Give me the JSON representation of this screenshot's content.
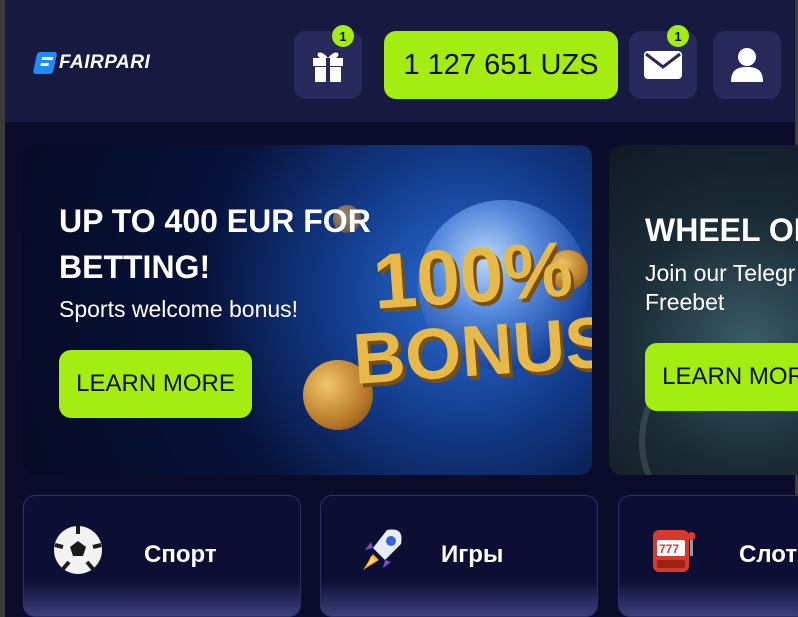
{
  "header": {
    "logo_text": "FAIRPARI",
    "gift_badge": "1",
    "balance": "1 127 651 UZS",
    "mail_badge": "1"
  },
  "banners": [
    {
      "title_line1": "UP TO 400 EUR FOR",
      "title_line2": "BETTING!",
      "subtitle": "Sports welcome bonus!",
      "cta": "LEARN MORE",
      "art_pct": "100%",
      "art_word": "BONUS"
    },
    {
      "title": "WHEEL OF",
      "subtitle_line1": "Join our Telegr",
      "subtitle_line2": "Freebet",
      "cta": "LEARN MORE"
    }
  ],
  "categories": [
    {
      "label": "Спорт",
      "icon": "soccer-ball-icon"
    },
    {
      "label": "Игры",
      "icon": "rocket-icon"
    },
    {
      "label": "Слоты",
      "icon": "slot-machine-icon"
    }
  ],
  "colors": {
    "accent": "#a3ed12",
    "header_bg": "#171941",
    "page_bg": "#0b0b2a",
    "logo_blue": "#1e8bff"
  }
}
